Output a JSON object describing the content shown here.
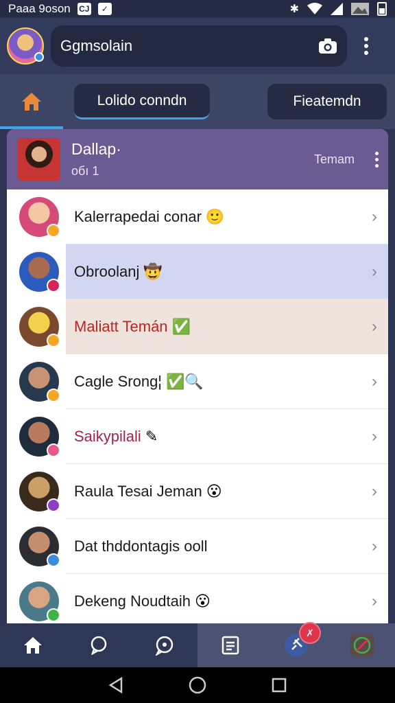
{
  "status_bar": {
    "left_text": "Paaa 9oson",
    "left_box_1": "CJ",
    "left_box_2": "✓"
  },
  "app_bar": {
    "search_text": "Ggmsolain"
  },
  "tabs": {
    "tab1_label": "Lolido conndn",
    "tab2_label": "Fieatemdn"
  },
  "card_header": {
    "title": "Dallap·",
    "subtitle": "oбı 1",
    "action_label": "Temam"
  },
  "rows": [
    {
      "name": "Kalerrapedai conar",
      "emoji": "🙂",
      "avatar_colors": [
        "#f6c7a4",
        "#d64a7a"
      ],
      "status_color": "#f5a623",
      "name_color": "#1a1a1a"
    },
    {
      "name": "Obroolanj",
      "emoji": "🤠",
      "avatar_colors": [
        "#a56c4f",
        "#2b5bbd"
      ],
      "status_color": "#d6245c",
      "name_color": "#1a1a1a"
    },
    {
      "name": "Maliatt Temán",
      "emoji": "✅",
      "avatar_colors": [
        "#f3d14a",
        "#7a4a2e"
      ],
      "status_color": "#f5a623",
      "name_color": "#b8261f"
    },
    {
      "name": "Cagle Srong¦",
      "emoji": "✅🔍",
      "avatar_colors": [
        "#c89274",
        "#273a4d"
      ],
      "status_color": "#f5a623",
      "name_color": "#1a1a1a"
    },
    {
      "name": "Saikypilali",
      "emoji": "✎",
      "avatar_colors": [
        "#b87b5e",
        "#1e2c3c"
      ],
      "status_color": "#e85a8c",
      "name_color": "#a3224f"
    },
    {
      "name": "Raula Tesai Jeman",
      "emoji": "😮",
      "avatar_colors": [
        "#caa068",
        "#3a2a1c"
      ],
      "status_color": "#8a3fc5",
      "name_color": "#1a1a1a"
    },
    {
      "name": "Dat thddontagis ooll",
      "emoji": "",
      "avatar_colors": [
        "#c58e6e",
        "#2b2d33"
      ],
      "status_color": "#3a8dde",
      "name_color": "#1a1a1a"
    },
    {
      "name": "Dekeng Noudtaih",
      "emoji": "😮",
      "avatar_colors": [
        "#d8a483",
        "#4a7a8a"
      ],
      "status_color": "#3bb54a",
      "name_color": "#1a1a1a"
    }
  ],
  "bottom_nav": {
    "badge_icon": "✗"
  },
  "colors": {
    "accent": "#3aa7e6",
    "header_purple": "#6c5a92",
    "highlight_blue": "#d2d6f1",
    "highlight_peach": "#efe3dd"
  }
}
